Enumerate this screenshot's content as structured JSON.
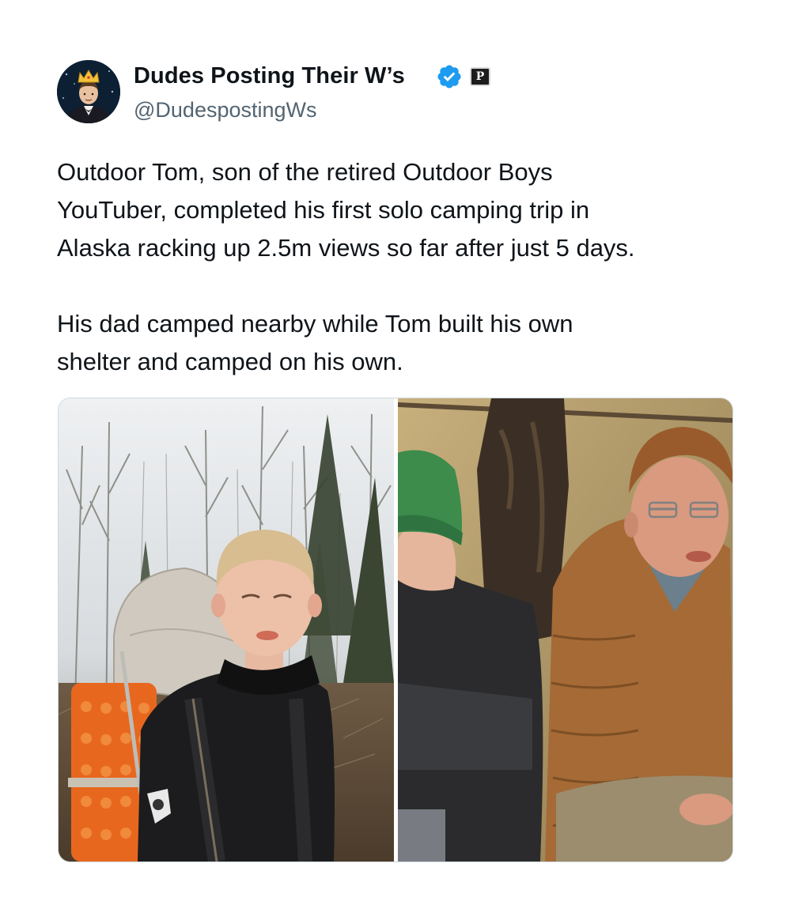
{
  "author": {
    "display_name": "Dudes Posting Their W’s",
    "handle": "@DudespostingWs",
    "avatar_icon": "avatar-crowned-man",
    "verified_icon": "verified-badge-icon",
    "affiliate_icon": "p-badge-icon",
    "affiliate_glyph": "P",
    "verified_color": "#1d9bf0"
  },
  "tweet": {
    "paragraphs": [
      {
        "lines": [
          "Outdoor Tom, son of the retired Outdoor Boys",
          "YouTuber, completed his first solo camping trip in",
          "Alaska racking up 2.5m views so far after just 5 days."
        ]
      },
      {
        "lines": [
          "His dad camped nearby while Tom built his own",
          "shelter and camped on his own."
        ]
      }
    ]
  },
  "media": [
    {
      "name": "photo-boy-with-backpack-in-forest"
    },
    {
      "name": "photo-father-and-son-in-tent"
    }
  ]
}
